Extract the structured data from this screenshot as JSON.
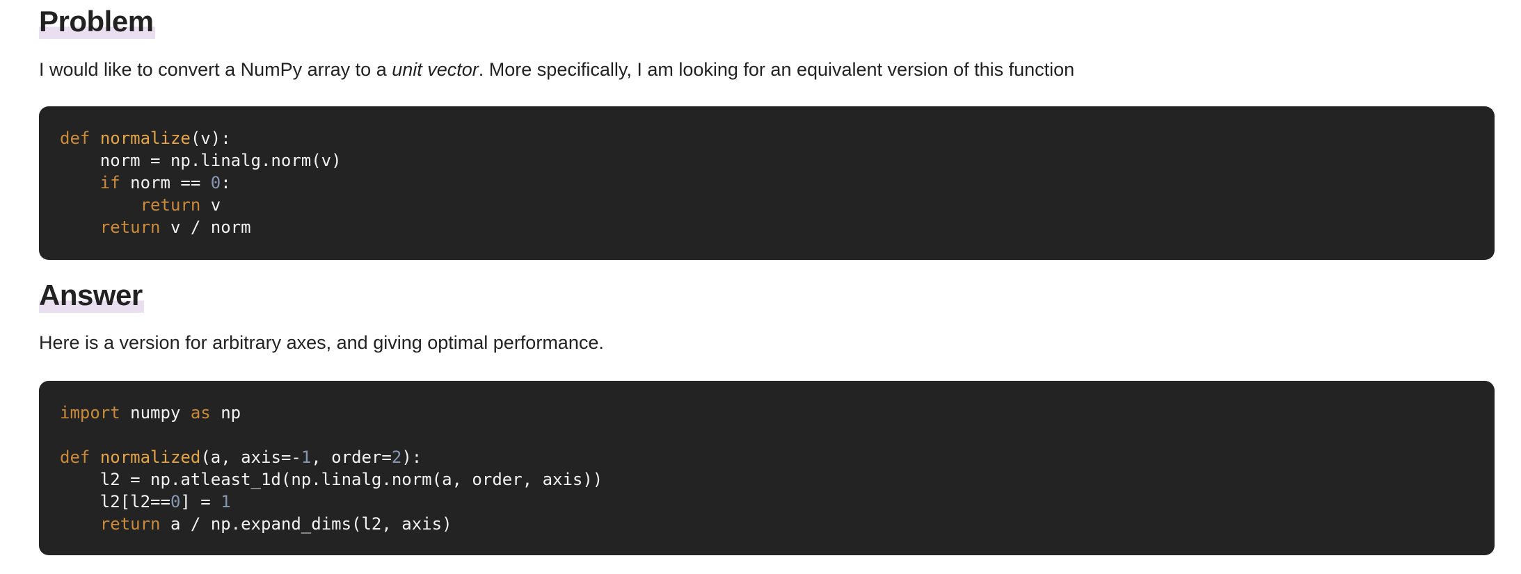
{
  "problem": {
    "heading": "Problem",
    "text_before": "I would like to convert a NumPy array to a ",
    "text_emphasis": "unit vector",
    "text_after": ". More specifically, I am looking for an equivalent version of this function",
    "code": [
      [
        [
          "def",
          "kw"
        ],
        [
          " ",
          "plain"
        ],
        [
          "normalize",
          "fn"
        ],
        [
          "(v):",
          "plain"
        ]
      ],
      [
        [
          "    norm = np.linalg.norm(v)",
          "plain"
        ]
      ],
      [
        [
          "    ",
          "plain"
        ],
        [
          "if",
          "kw"
        ],
        [
          " norm == ",
          "plain"
        ],
        [
          "0",
          "num"
        ],
        [
          ":",
          "plain"
        ]
      ],
      [
        [
          "        ",
          "plain"
        ],
        [
          "return",
          "kw"
        ],
        [
          " v",
          "plain"
        ]
      ],
      [
        [
          "    ",
          "plain"
        ],
        [
          "return",
          "kw"
        ],
        [
          " v / norm",
          "plain"
        ]
      ]
    ]
  },
  "answer": {
    "heading": "Answer",
    "text": "Here is a version for arbitrary axes, and giving optimal performance.",
    "code": [
      [
        [
          "import",
          "kw"
        ],
        [
          " numpy ",
          "plain"
        ],
        [
          "as",
          "kw"
        ],
        [
          " np",
          "plain"
        ]
      ],
      [
        [
          "",
          "plain"
        ]
      ],
      [
        [
          "def",
          "kw"
        ],
        [
          " ",
          "plain"
        ],
        [
          "normalized",
          "fn"
        ],
        [
          "(a, axis=-",
          "plain"
        ],
        [
          "1",
          "num"
        ],
        [
          ", order=",
          "plain"
        ],
        [
          "2",
          "num"
        ],
        [
          "):",
          "plain"
        ]
      ],
      [
        [
          "    l2 = np.atleast_1d(np.linalg.norm(a, order, axis))",
          "plain"
        ]
      ],
      [
        [
          "    l2[l2==",
          "plain"
        ],
        [
          "0",
          "num"
        ],
        [
          "] = ",
          "plain"
        ],
        [
          "1",
          "num"
        ]
      ],
      [
        [
          "    ",
          "plain"
        ],
        [
          "return",
          "kw"
        ],
        [
          " a / np.expand_dims(l2, axis)",
          "plain"
        ]
      ]
    ]
  },
  "colors": {
    "code_bg": "#232323",
    "keyword": "#c98a3a",
    "function": "#e3a548",
    "number": "#8797b0",
    "heading_highlight": "#e9dff0"
  }
}
